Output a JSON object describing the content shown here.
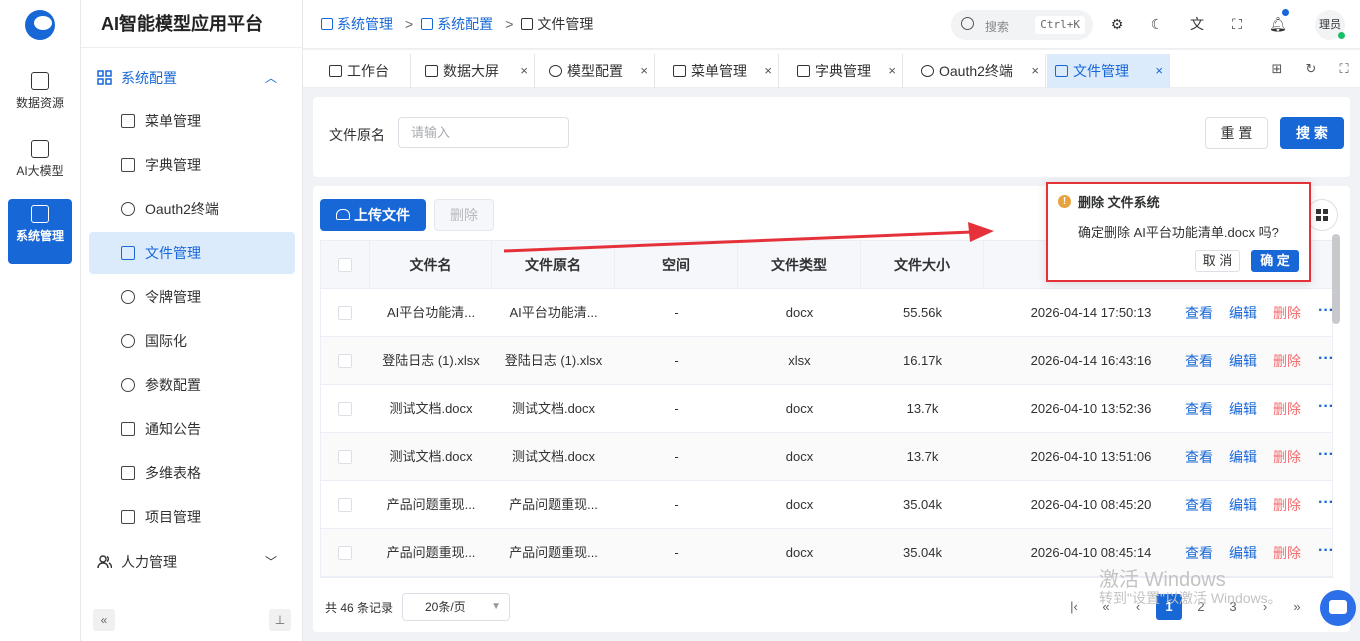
{
  "rail": {
    "items": [
      {
        "label": "数据资源"
      },
      {
        "label": "AI大模型"
      },
      {
        "label": "系统管理"
      }
    ]
  },
  "sidebar": {
    "title": "AI智能模型应用平台",
    "group_open": "系统配置",
    "items": [
      {
        "label": "菜单管理"
      },
      {
        "label": "字典管理"
      },
      {
        "label": "Oauth2终端"
      },
      {
        "label": "文件管理"
      },
      {
        "label": "令牌管理"
      },
      {
        "label": "国际化"
      },
      {
        "label": "参数配置"
      },
      {
        "label": "通知公告"
      },
      {
        "label": "多维表格"
      },
      {
        "label": "项目管理"
      }
    ],
    "group_closed": "人力管理",
    "collapse_glyph": "«",
    "pin_glyph": "⊥"
  },
  "header": {
    "crumb1": "系统管理",
    "crumb2": "系统配置",
    "crumb3": "文件管理",
    "sep": ">",
    "search_label": "搜索",
    "search_kbd": "Ctrl+K",
    "avatar": "理员"
  },
  "tabs": [
    {
      "label": "工作台"
    },
    {
      "label": "数据大屏"
    },
    {
      "label": "模型配置"
    },
    {
      "label": "菜单管理"
    },
    {
      "label": "字典管理"
    },
    {
      "label": "Oauth2终端"
    },
    {
      "label": "文件管理"
    }
  ],
  "tab_close": "×",
  "filter": {
    "label": "文件原名",
    "placeholder": "请输入",
    "reset": "重 置",
    "search": "搜 索"
  },
  "toolbar": {
    "upload": "上传文件",
    "delete": "删除"
  },
  "table": {
    "headers": [
      "文件名",
      "文件原名",
      "空间",
      "文件类型",
      "文件大小"
    ],
    "rows": [
      {
        "name": "AI平台功能清...",
        "orig": "AI平台功能清...",
        "space": "-",
        "type": "docx",
        "size": "55.56k",
        "time": "2026-04-14 17:50:13"
      },
      {
        "name": "登陆日志 (1).xlsx",
        "orig": "登陆日志 (1).xlsx",
        "space": "-",
        "type": "xlsx",
        "size": "16.17k",
        "time": "2026-04-14 16:43:16"
      },
      {
        "name": "测试文档.docx",
        "orig": "测试文档.docx",
        "space": "-",
        "type": "docx",
        "size": "13.7k",
        "time": "2026-04-10 13:52:36"
      },
      {
        "name": "测试文档.docx",
        "orig": "测试文档.docx",
        "space": "-",
        "type": "docx",
        "size": "13.7k",
        "time": "2026-04-10 13:51:06"
      },
      {
        "name": "产品问题重现...",
        "orig": "产品问题重现...",
        "space": "-",
        "type": "docx",
        "size": "35.04k",
        "time": "2026-04-10 08:45:20"
      },
      {
        "name": "产品问题重现...",
        "orig": "产品问题重现...",
        "space": "-",
        "type": "docx",
        "size": "35.04k",
        "time": "2026-04-10 08:45:14"
      }
    ],
    "action_view": "查看",
    "action_edit": "编辑",
    "action_delete": "删除",
    "action_more": "···"
  },
  "pagination": {
    "total": "共 46 条记录",
    "page_size": "20条/页",
    "first": "|‹",
    "prev_group": "«",
    "prev": "‹",
    "pages": [
      "1",
      "2",
      "3"
    ],
    "next": "›",
    "next_group": "»"
  },
  "popconfirm": {
    "title": "删除 文件系统",
    "message": "确定删除 AI平台功能清单.docx 吗?",
    "cancel": "取 消",
    "ok": "确 定"
  },
  "watermark": {
    "line1": "激活 Windows",
    "line2": "转到\"设置\"以激活 Windows。"
  },
  "colors": {
    "primary": "#1767d7",
    "danger": "#f56c6c",
    "annotation": "#e5323a"
  }
}
